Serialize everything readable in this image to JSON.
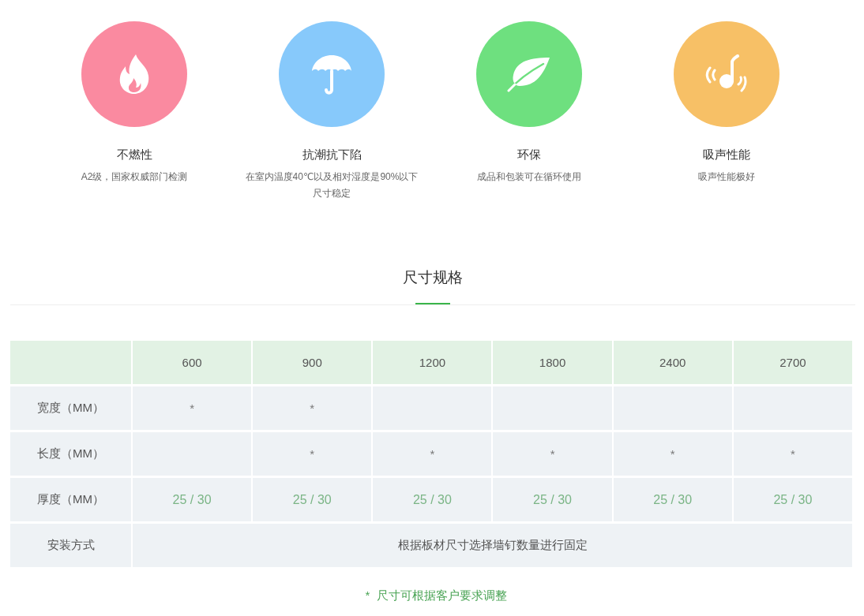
{
  "features": [
    {
      "kind": "fire",
      "color": "#fa8aa0",
      "title": "不燃性",
      "lines": [
        "A2级，国家权威部门检测"
      ]
    },
    {
      "kind": "umbrella",
      "color": "#87c9fb",
      "title": "抗潮抗下陷",
      "lines": [
        "在室内温度40℃以及相对湿度是90%以下",
        "尺寸稳定"
      ]
    },
    {
      "kind": "leaf",
      "color": "#6ee07f",
      "title": "环保",
      "lines": [
        "成品和包装可在循环使用"
      ]
    },
    {
      "kind": "sound",
      "color": "#f7c066",
      "title": "吸声性能",
      "lines": [
        "吸声性能极好"
      ]
    }
  ],
  "section_title": "尺寸规格",
  "table": {
    "columns": [
      "600",
      "900",
      "1200",
      "1800",
      "2400",
      "2700"
    ],
    "rows": [
      {
        "kind": "marks",
        "label": "宽度（MM）",
        "cells": [
          "*",
          "*",
          null,
          null,
          null,
          null
        ]
      },
      {
        "kind": "marks",
        "label": "长度（MM）",
        "cells": [
          null,
          "*",
          "*",
          "*",
          "*",
          "*"
        ]
      },
      {
        "kind": "values",
        "label": "厚度（MM）",
        "cells": [
          "25 / 30",
          "25 / 30",
          "25 / 30",
          "25 / 30",
          "25 / 30",
          "25 / 30"
        ]
      },
      {
        "kind": "span",
        "label": "安装方式",
        "text": "根据板材尺寸选择墙钉数量进行固定"
      }
    ]
  },
  "footnote": "*  尺寸可根据客户要求调整"
}
